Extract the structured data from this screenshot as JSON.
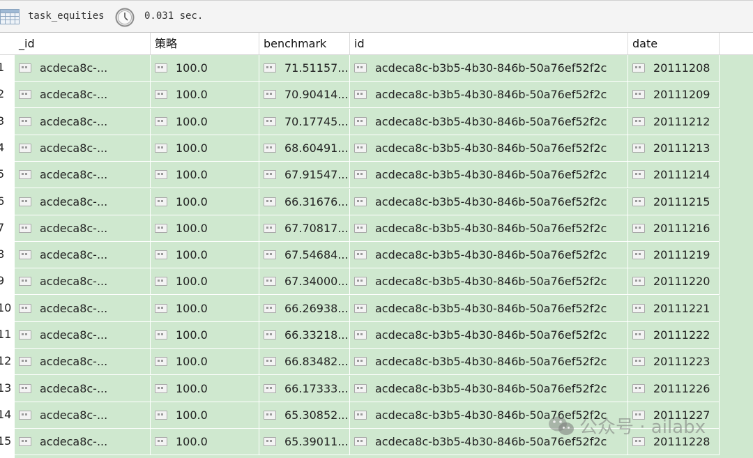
{
  "toolbar": {
    "collection": "task_equities",
    "query_time": "0.031 sec."
  },
  "columns": [
    "_id",
    "策略",
    "benchmark",
    "id",
    "date"
  ],
  "rows": [
    {
      "n": "1",
      "_id": "acdeca8c-...",
      "strategy": "100.0",
      "benchmark": "71.51157...",
      "id": "acdeca8c-b3b5-4b30-846b-50a76ef52f2c",
      "date": "20111208"
    },
    {
      "n": "2",
      "_id": "acdeca8c-...",
      "strategy": "100.0",
      "benchmark": "70.90414...",
      "id": "acdeca8c-b3b5-4b30-846b-50a76ef52f2c",
      "date": "20111209"
    },
    {
      "n": "3",
      "_id": "acdeca8c-...",
      "strategy": "100.0",
      "benchmark": "70.17745...",
      "id": "acdeca8c-b3b5-4b30-846b-50a76ef52f2c",
      "date": "20111212"
    },
    {
      "n": "4",
      "_id": "acdeca8c-...",
      "strategy": "100.0",
      "benchmark": "68.60491...",
      "id": "acdeca8c-b3b5-4b30-846b-50a76ef52f2c",
      "date": "20111213"
    },
    {
      "n": "5",
      "_id": "acdeca8c-...",
      "strategy": "100.0",
      "benchmark": "67.91547...",
      "id": "acdeca8c-b3b5-4b30-846b-50a76ef52f2c",
      "date": "20111214"
    },
    {
      "n": "6",
      "_id": "acdeca8c-...",
      "strategy": "100.0",
      "benchmark": "66.31676...",
      "id": "acdeca8c-b3b5-4b30-846b-50a76ef52f2c",
      "date": "20111215"
    },
    {
      "n": "7",
      "_id": "acdeca8c-...",
      "strategy": "100.0",
      "benchmark": "67.70817...",
      "id": "acdeca8c-b3b5-4b30-846b-50a76ef52f2c",
      "date": "20111216"
    },
    {
      "n": "8",
      "_id": "acdeca8c-...",
      "strategy": "100.0",
      "benchmark": "67.54684...",
      "id": "acdeca8c-b3b5-4b30-846b-50a76ef52f2c",
      "date": "20111219"
    },
    {
      "n": "9",
      "_id": "acdeca8c-...",
      "strategy": "100.0",
      "benchmark": "67.34000...",
      "id": "acdeca8c-b3b5-4b30-846b-50a76ef52f2c",
      "date": "20111220"
    },
    {
      "n": "10",
      "_id": "acdeca8c-...",
      "strategy": "100.0",
      "benchmark": "66.26938...",
      "id": "acdeca8c-b3b5-4b30-846b-50a76ef52f2c",
      "date": "20111221"
    },
    {
      "n": "11",
      "_id": "acdeca8c-...",
      "strategy": "100.0",
      "benchmark": "66.33218...",
      "id": "acdeca8c-b3b5-4b30-846b-50a76ef52f2c",
      "date": "20111222"
    },
    {
      "n": "12",
      "_id": "acdeca8c-...",
      "strategy": "100.0",
      "benchmark": "66.83482...",
      "id": "acdeca8c-b3b5-4b30-846b-50a76ef52f2c",
      "date": "20111223"
    },
    {
      "n": "13",
      "_id": "acdeca8c-...",
      "strategy": "100.0",
      "benchmark": "66.17333...",
      "id": "acdeca8c-b3b5-4b30-846b-50a76ef52f2c",
      "date": "20111226"
    },
    {
      "n": "14",
      "_id": "acdeca8c-...",
      "strategy": "100.0",
      "benchmark": "65.30852...",
      "id": "acdeca8c-b3b5-4b30-846b-50a76ef52f2c",
      "date": "20111227"
    },
    {
      "n": "15",
      "_id": "acdeca8c-...",
      "strategy": "100.0",
      "benchmark": "65.39011...",
      "id": "acdeca8c-b3b5-4b30-846b-50a76ef52f2c",
      "date": "20111228"
    }
  ],
  "watermark": {
    "text": "公众号 · ailabx"
  },
  "icons": {
    "table": "table-icon",
    "timer": "clock-icon",
    "field_type": "field-type-icon"
  },
  "colors": {
    "row_background": "#cfe8cf",
    "toolbar_background": "#f4f4f4"
  }
}
